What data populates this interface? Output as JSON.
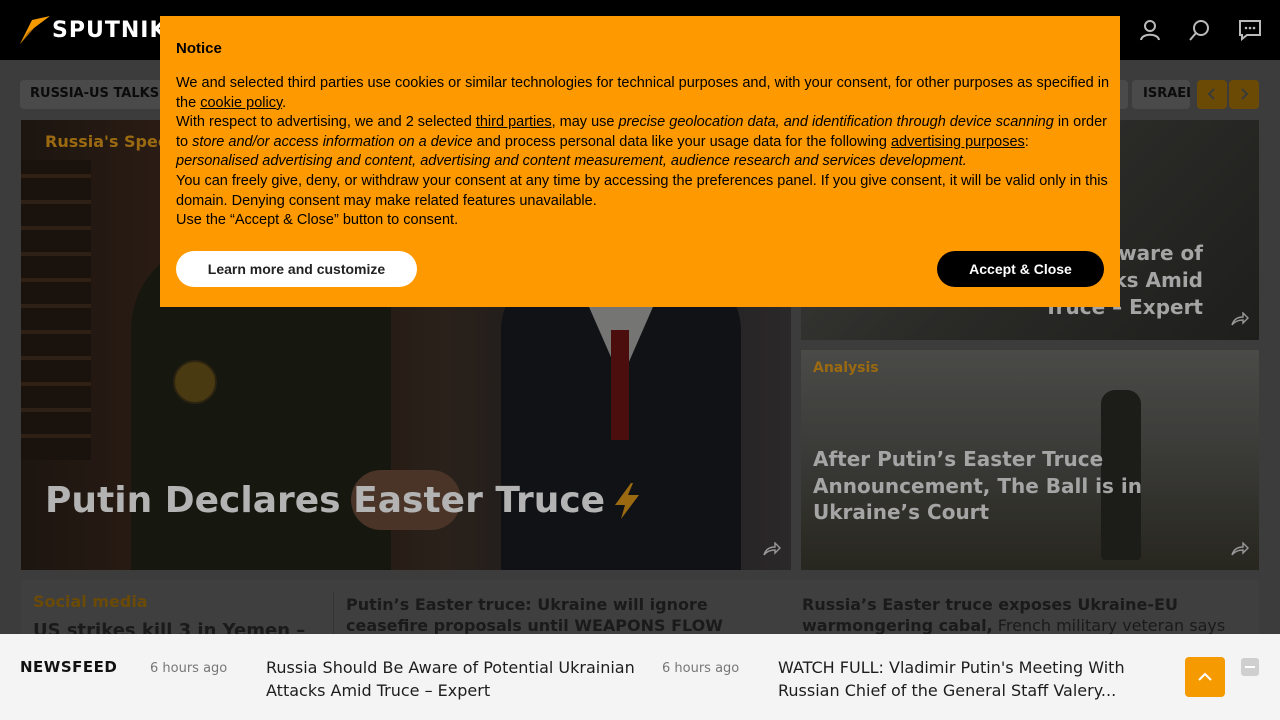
{
  "header": {
    "logo_text": "SPUTNIK",
    "icons": [
      "user-icon",
      "search-icon",
      "chat-icon"
    ]
  },
  "tags": [
    {
      "label": "RUSSIA-US TALKS ON"
    },
    {
      "label": "ISRAEL"
    }
  ],
  "hero": {
    "category": "Russia's Special Operation",
    "title": "Putin Declares Easter Truce",
    "badge": "lightning-icon"
  },
  "side_top": {
    "title": "Russia Should Be Aware of Potential Ukrainian Attacks Amid Truce – Expert"
  },
  "side_bottom": {
    "category": "Analysis",
    "title": "After Putin’s Easter Truce Announcement, The Ball is in Ukraine’s Court"
  },
  "bottom_strip": {
    "category": "Social media",
    "item1": "US strikes kill 3 in Yemen –",
    "item2": "Putin’s Easter truce: Ukraine will ignore ceasefire proposals until WEAPONS FLOW stops, jo...",
    "item3_bold": "Russia’s Easter truce exposes Ukraine-EU warmongering cabal,",
    "item3_rest": " French military veteran says"
  },
  "newsfeed": {
    "label": "NEWSFEED",
    "items": [
      {
        "time": "6 hours ago",
        "text": "Russia Should Be Aware of Potential Ukrainian Attacks Amid Truce – Expert"
      },
      {
        "time": "6 hours ago",
        "text": "WATCH FULL: Vladimir Putin's Meeting With Russian Chief of the General Staff Valery..."
      }
    ]
  },
  "consent": {
    "title": "Notice",
    "p1_a": "We and selected third parties use cookies or similar technologies for technical purposes and, with your consent, for other purposes as specified in the ",
    "p1_link": "cookie policy",
    "p1_b": ".",
    "p2_a": "With respect to advertising, we and 2 selected ",
    "p2_link1": "third parties",
    "p2_b": ", may use ",
    "p2_i1": "precise geolocation data, and identification through device scanning",
    "p2_c": " in order to ",
    "p2_i2": "store and/or access information on a device",
    "p2_d": " and process personal data like your usage data for the following ",
    "p2_link2": "advertising purposes",
    "p2_e": ": ",
    "p2_i3": "personalised advertising and content, advertising and content measurement, audience research and services development.",
    "p3": "You can freely give, deny, or withdraw your consent at any time by accessing the preferences panel. If you give consent, it will be valid only in this domain. Denying consent may make related features unavailable.",
    "p4": "Use the “Accept & Close” button to consent.",
    "learn_button": "Learn more and customize",
    "accept_button": "Accept & Close"
  },
  "colors": {
    "accent": "#ff9900",
    "header_bg": "#000000",
    "newsfeed_bg": "#f4f4f4"
  }
}
